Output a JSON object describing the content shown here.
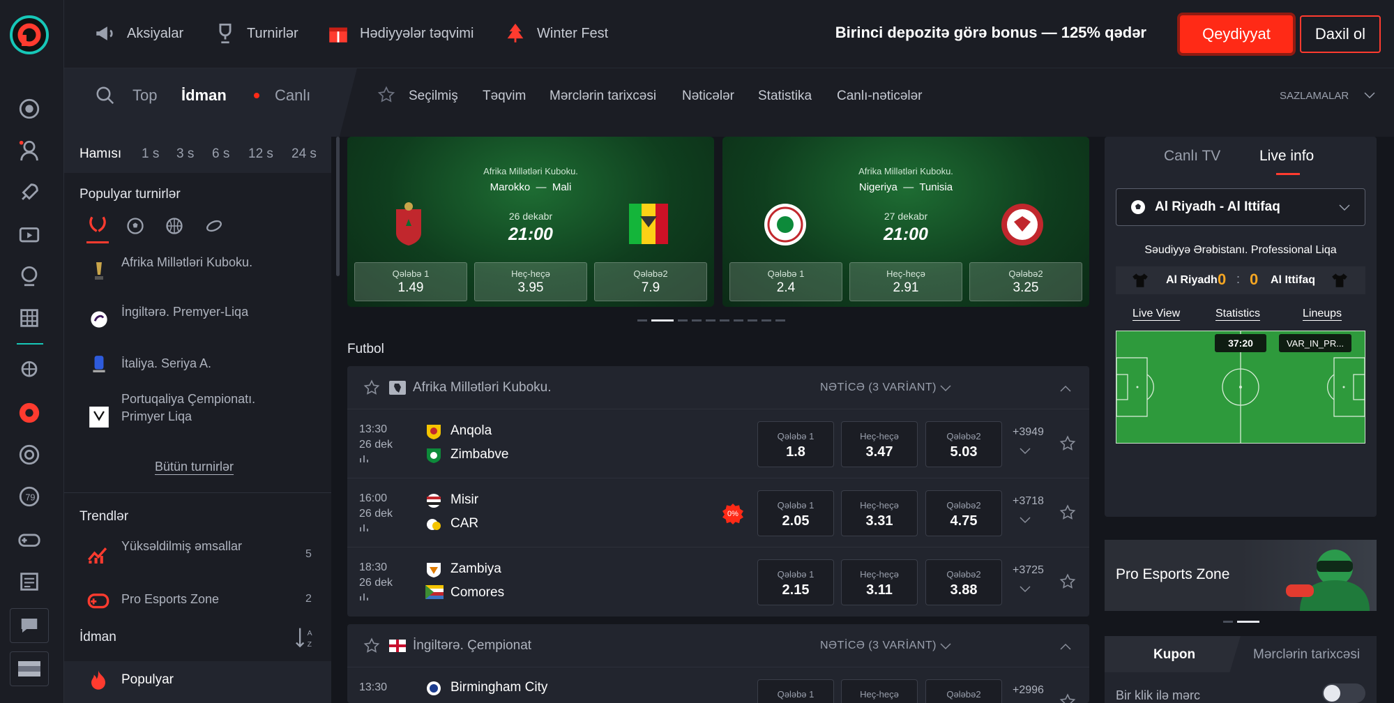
{
  "topbar": {
    "nav": [
      {
        "label": "Aksiyalar",
        "icon": "megaphone-icon"
      },
      {
        "label": "Turnirlər",
        "icon": "trophy-icon"
      },
      {
        "label": "Hədiyyələr təqvimi",
        "icon": "gift-calendar-icon"
      },
      {
        "label": "Winter Fest",
        "icon": "christmas-tree-icon"
      }
    ],
    "promo": "Birinci depozitə görə bonus — 125% qədər",
    "register": "Qeydiyyat",
    "login": "Daxil ol"
  },
  "bar2": {
    "top": "Top",
    "sport": "İdman",
    "live": "Canlı",
    "links": [
      "Seçilmiş",
      "Təqvim",
      "Mərclərin tarixcəsi",
      "Nəticələr",
      "Statistika",
      "Canlı-nəticələr"
    ],
    "settings": "SAZLAMALAR"
  },
  "left": {
    "time_filters": [
      "Hamısı",
      "1 s",
      "3 s",
      "6 s",
      "12 s",
      "24 s"
    ],
    "popular_title": "Populyar turnirlər",
    "tournaments": [
      "Afrika Millətləri Kuboku.",
      "İngiltərə. Premyer-Liqa",
      "İtaliya. Seriya A.",
      "Portuqaliya Çempionatı. Primyer Liqa"
    ],
    "all_tournaments": "Bütün turnirlər",
    "trends_title": "Trendlər",
    "trends": [
      {
        "label": "Yüksəldilmiş əmsallar",
        "count": "5"
      },
      {
        "label": "Pro Esports Zone",
        "count": "2"
      }
    ],
    "sport_title": "İdman",
    "sort_label": "A Z",
    "popular_item": "Populyar"
  },
  "banners": [
    {
      "league": "Afrika Millətləri Kuboku.",
      "home": "Marokko",
      "away": "Mali",
      "date": "26 dekabr",
      "time": "21:00",
      "odds": [
        {
          "label": "Qələbə 1",
          "value": "1.49"
        },
        {
          "label": "Heç-heçə",
          "value": "3.95"
        },
        {
          "label": "Qələbə2",
          "value": "7.9"
        }
      ]
    },
    {
      "league": "Afrika Millətləri Kuboku.",
      "home": "Nigeriya",
      "away": "Tunisia",
      "date": "27 dekabr",
      "time": "21:00",
      "odds": [
        {
          "label": "Qələbə 1",
          "value": "2.4"
        },
        {
          "label": "Heç-heçə",
          "value": "2.91"
        },
        {
          "label": "Qələbə2",
          "value": "3.25"
        }
      ]
    }
  ],
  "section_title": "Futbol",
  "leagues": [
    {
      "name": "Afrika Millətləri Kuboku.",
      "market": "NƏTİCƏ (3 VARİANT)",
      "matches": [
        {
          "time": "13:30",
          "date": "26 dek",
          "home": "Anqola",
          "away": "Zimbabve",
          "odds": [
            "1.8",
            "3.47",
            "5.03"
          ],
          "more": "+3949"
        },
        {
          "time": "16:00",
          "date": "26 dek",
          "home": "Misir",
          "away": "CAR",
          "odds": [
            "2.05",
            "3.31",
            "4.75"
          ],
          "more": "+3718",
          "badge": "0%"
        },
        {
          "time": "18:30",
          "date": "26 dek",
          "home": "Zambiya",
          "away": "Comores",
          "odds": [
            "2.15",
            "3.11",
            "3.88"
          ],
          "more": "+3725"
        }
      ]
    },
    {
      "name": "İngiltərə. Çempionat",
      "market": "NƏTİCƏ (3 VARİANT)",
      "matches": [
        {
          "time": "13:30",
          "date": "",
          "home": "Birmingham City",
          "away": "",
          "odds": [
            "",
            "",
            ""
          ],
          "more": "+2996"
        }
      ]
    }
  ],
  "odd_labels": [
    "Qələbə 1",
    "Heç-heçə",
    "Qələbə2"
  ],
  "right": {
    "tabs": [
      "Canlı TV",
      "Live info"
    ],
    "match": "Al Riyadh - Al Ittifaq",
    "league": "Səudiyyə Ərəbistanı. Professional Liqa",
    "home": "Al Riyadh",
    "home_score": "0",
    "away_score": "0",
    "away": "Al Ittifaq",
    "links": [
      "Live View",
      "Statistics",
      "Lineups"
    ],
    "clock": "37:20",
    "event": "VAR_IN_PR..."
  },
  "esports": {
    "label": "Pro Esports Zone"
  },
  "coupon": {
    "tabs": [
      "Kupon",
      "Mərclərin tarixcəsi"
    ],
    "one_click": "Bir klik ilə mərc"
  },
  "colors": {
    "accent": "#ff2a16",
    "bg": "#14161c",
    "panel": "#1b1d24",
    "card": "#22252e",
    "score": "#f5a623",
    "pitch": "#2e9a3c"
  }
}
